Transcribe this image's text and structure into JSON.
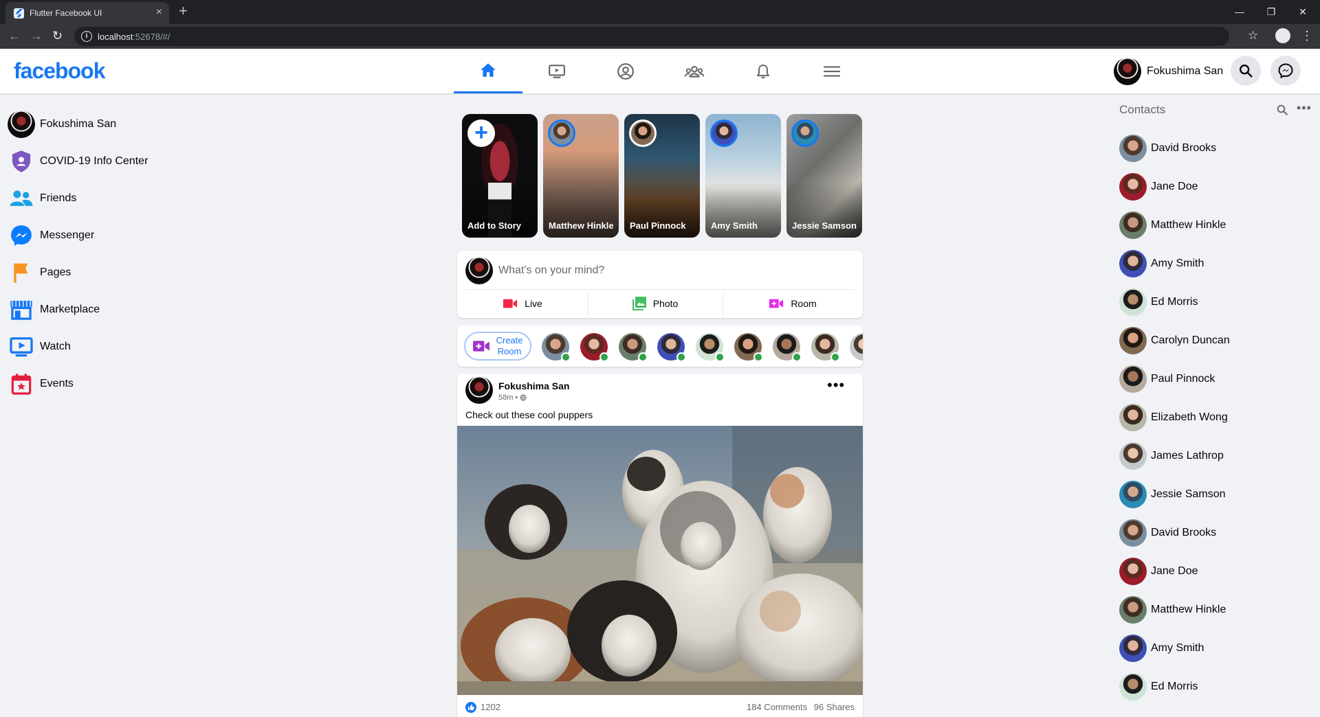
{
  "browser": {
    "tab_title": "Flutter Facebook UI",
    "tab_close": "×",
    "new_tab": "+",
    "url_host": "localhost",
    "url_rest": ":52678/#/",
    "window_controls": [
      "—",
      "❐",
      "✕"
    ]
  },
  "header": {
    "logo": "facebook",
    "nav_tabs": [
      {
        "name": "home",
        "icon": "home-icon",
        "active": true
      },
      {
        "name": "watch",
        "icon": "ondemand-video-icon",
        "active": false
      },
      {
        "name": "profile",
        "icon": "account-circle-icon",
        "active": false
      },
      {
        "name": "groups",
        "icon": "group-icon",
        "active": false
      },
      {
        "name": "notifications",
        "icon": "bell-icon",
        "active": false
      },
      {
        "name": "menu",
        "icon": "menu-icon",
        "active": false
      }
    ],
    "user_name": "Fokushima San",
    "accent": "#1877f2"
  },
  "left_sidebar": {
    "items": [
      {
        "label": "Fokushima San",
        "icon": "avatar"
      },
      {
        "label": "COVID-19 Info Center",
        "icon": "shield-icon"
      },
      {
        "label": "Friends",
        "icon": "friends-icon"
      },
      {
        "label": "Messenger",
        "icon": "messenger-icon"
      },
      {
        "label": "Pages",
        "icon": "flag-icon"
      },
      {
        "label": "Marketplace",
        "icon": "storefront-icon"
      },
      {
        "label": "Watch",
        "icon": "ondemand-video-icon"
      },
      {
        "label": "Events",
        "icon": "calendar-icon"
      }
    ]
  },
  "stories": [
    {
      "label": "Add to Story",
      "kind": "add"
    },
    {
      "label": "Matthew Hinkle",
      "kind": "story"
    },
    {
      "label": "Paul Pinnock",
      "kind": "story"
    },
    {
      "label": "Amy Smith",
      "kind": "story"
    },
    {
      "label": "Jessie Samson",
      "kind": "story"
    }
  ],
  "composer": {
    "placeholder": "What's on your mind?",
    "actions": [
      {
        "label": "Live",
        "icon": "videocam-icon",
        "color": "#f02849"
      },
      {
        "label": "Photo",
        "icon": "photo-library-icon",
        "color": "#45bd62"
      },
      {
        "label": "Room",
        "icon": "video-call-icon",
        "color": "#e42ae8"
      }
    ]
  },
  "rooms": {
    "create_label": "Create Room",
    "online_color": "#31a24c"
  },
  "post": {
    "author": "Fokushima San",
    "time": "58m",
    "separator": "•",
    "more": "•••",
    "caption": "Check out these cool puppers",
    "likes": "1202",
    "comments": "184 Comments",
    "shares": "96 Shares"
  },
  "contacts": {
    "title": "Contacts",
    "more": "•••",
    "items": [
      "David Brooks",
      "Jane Doe",
      "Matthew Hinkle",
      "Amy Smith",
      "Ed Morris",
      "Carolyn Duncan",
      "Paul Pinnock",
      "Elizabeth Wong",
      "James Lathrop",
      "Jessie Samson",
      "David Brooks",
      "Jane Doe",
      "Matthew Hinkle",
      "Amy Smith",
      "Ed Morris"
    ]
  }
}
